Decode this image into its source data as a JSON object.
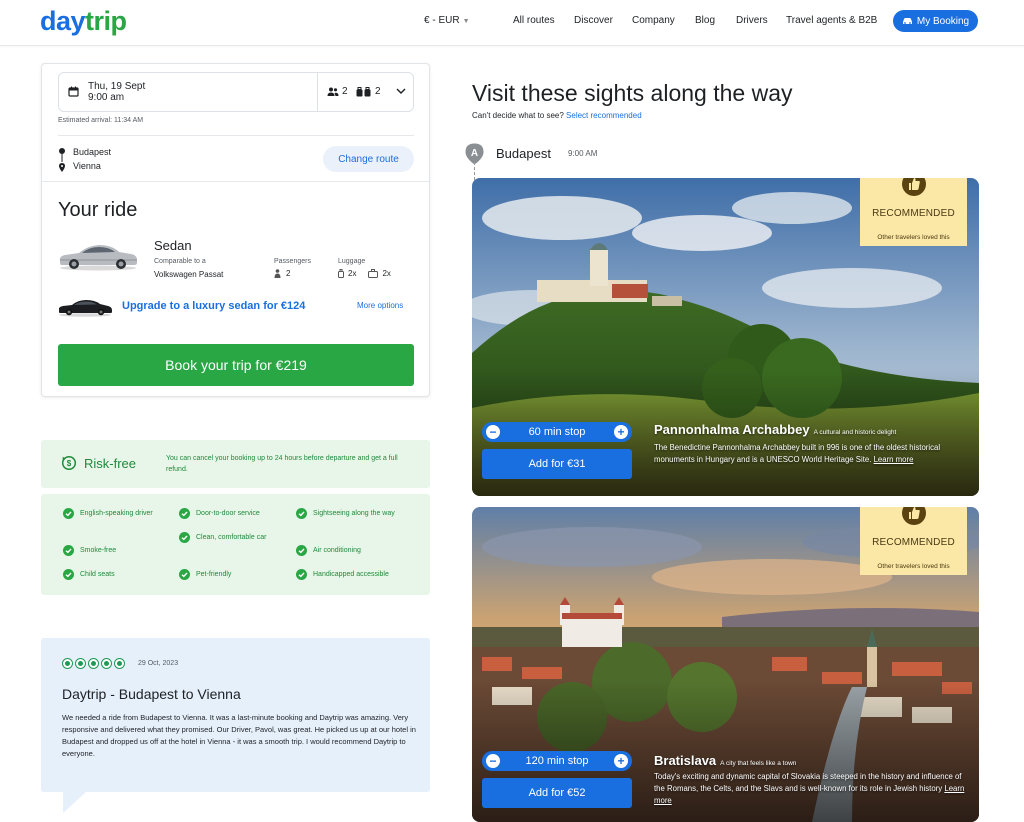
{
  "header": {
    "logo_part1": "day",
    "logo_part2": "trip",
    "currency": "€ - EUR",
    "nav": [
      "All routes",
      "Discover",
      "Company",
      "Blog",
      "Drivers",
      "Travel agents & B2B"
    ],
    "my_booking": "My Booking"
  },
  "booking": {
    "date": "Thu, 19 Sept",
    "time": "9:00 am",
    "passengers": "2",
    "luggage": "2",
    "estimated_arrival": "Estimated arrival: 11:34 AM",
    "from": "Budapest",
    "to": "Vienna",
    "change_route": "Change route"
  },
  "ride": {
    "title": "Your ride",
    "car": "Sedan",
    "comparable_label": "Comparable to a",
    "comparable_value": "Volkswagen Passat",
    "passengers_label": "Passengers",
    "passengers_value": "2",
    "luggage_label": "Luggage",
    "luggage_small": "2x",
    "luggage_large": "2x",
    "upgrade": "Upgrade to a luxury sedan for €124",
    "more_options": "More options",
    "book_button": "Book your trip for €219"
  },
  "risk": {
    "title": "Risk-free",
    "description": "You can cancel your booking up to 24 hours before departure and get a full refund."
  },
  "features": [
    "English-speaking driver",
    "Door-to-door service",
    "Sightseeing along the way",
    "Smoke-free",
    "Clean, comfortable car",
    "Air conditioning",
    "Child seats",
    "Pet-friendly",
    "Handicapped accessible"
  ],
  "review": {
    "date": "29 Oct, 2023",
    "title": "Daytrip - Budapest to Vienna",
    "text": "We needed a ride from Budapest to Vienna. It was a last-minute booking and Daytrip was amazing. Very responsive and delivered what they promised. Our Driver, Pavol, was great. He picked us up at our hotel in Budapest and dropped us off at the hotel in Vienna - it was a smooth trip. I would recommend Daytrip to everyone.",
    "rating": 5
  },
  "sights_section": {
    "title": "Visit these sights along the way",
    "cant_decide": "Can't decide what to see?",
    "select_recommended": "Select recommended",
    "start_marker": "A",
    "start_city": "Budapest",
    "start_time": "9:00 AM"
  },
  "sights": [
    {
      "recommended": "RECOMMENDED",
      "recommended_sub": "Other travelers loved this",
      "stop": "60 min stop",
      "add": "Add for €31",
      "name": "Pannonhalma Archabbey",
      "tag": "A cultural and historic delight",
      "desc": "The Benedictine Pannonhalma Archabbey built in 996 is one of the oldest historical monuments in Hungary and is a UNESCO World Heritage Site.",
      "learn_more": "Learn more"
    },
    {
      "recommended": "RECOMMENDED",
      "recommended_sub": "Other travelers loved this",
      "stop": "120 min stop",
      "add": "Add for €52",
      "name": "Bratislava",
      "tag": "A city that feels like a town",
      "desc": "Today's exciting and dynamic capital of Slovakia is steeped in the history and influence of the Romans, the Celts, and the Slavs and is well-known for its role in Jewish history",
      "learn_more": "Learn more"
    }
  ],
  "colors": {
    "brand_blue": "#1a6fe0",
    "brand_green": "#2aa745",
    "risk_bg": "#e8f6ea",
    "review_bg": "#e6f0fb",
    "recommended_bg": "#fbe7a6"
  }
}
